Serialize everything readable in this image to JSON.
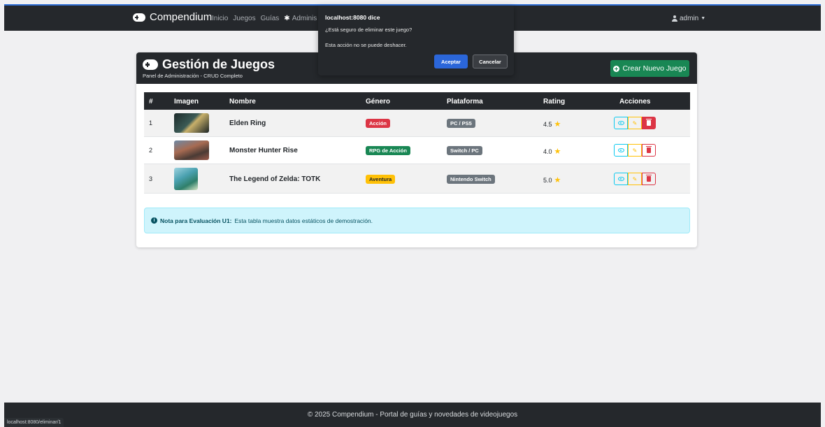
{
  "navbar": {
    "brand": "Compendium",
    "links": [
      "Inicio",
      "Juegos",
      "Guías"
    ],
    "admin_label": "Adminis",
    "user": "admin"
  },
  "dialog": {
    "title": "localhost:8080 dice",
    "message": "¿Está seguro de eliminar este juego?",
    "detail": "Esta acción no se puede deshacer.",
    "ok": "Aceptar",
    "cancel": "Cancelar"
  },
  "card": {
    "title": "Gestión de Juegos",
    "subtitle": "Panel de Administración - CRUD Completo",
    "create_button": "Crear Nuevo Juego"
  },
  "table": {
    "headers": [
      "#",
      "Imagen",
      "Nombre",
      "Género",
      "Plataforma",
      "Rating",
      "Acciones"
    ],
    "rows": [
      {
        "num": "1",
        "name": "Elden Ring",
        "genre": "Acción",
        "platform": "PC / PS5",
        "rating": "4.5"
      },
      {
        "num": "2",
        "name": "Monster Hunter Rise",
        "genre": "RPG de Acción",
        "platform": "Switch / PC",
        "rating": "4.0"
      },
      {
        "num": "3",
        "name": "The Legend of Zelda: TOTK",
        "genre": "Aventura",
        "platform": "Nintendo Switch",
        "rating": "5.0"
      }
    ]
  },
  "note": {
    "label": "Nota para Evaluación U1:",
    "text": "Esta tabla muestra datos estáticos de demostración."
  },
  "footer": {
    "text": "© 2025 Compendium - Portal de guías y novedades de videojuegos"
  },
  "status_url": "localhost:8080/eliminar/1",
  "colors": {
    "dark": "#25282c",
    "success": "#198754",
    "danger": "#dc3545",
    "warning": "#ffc107",
    "info": "#0dcaf0",
    "secondary": "#6c757d",
    "primary": "#2b66d9"
  }
}
